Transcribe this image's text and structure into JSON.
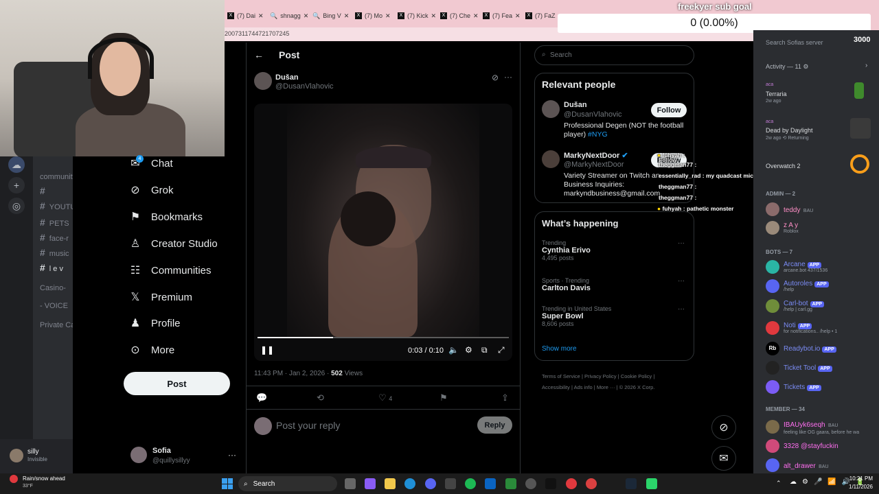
{
  "browser": {
    "tabs": [
      "(7) Dai",
      "shnagg",
      "Bing V",
      "(7) Mo",
      "(7) Kick",
      "(7) Che",
      "(7) Fea",
      "(7) FaZ"
    ],
    "address": "2007311744721707245"
  },
  "x": {
    "header_title": "Post",
    "nav": [
      "Chat",
      "Grok",
      "Bookmarks",
      "Creator Studio",
      "Communities",
      "Premium",
      "Profile",
      "More"
    ],
    "post_button": "Post",
    "account": {
      "name": "Sofia",
      "handle": "@quillysillyy"
    },
    "chat_badge": "4",
    "tweet": {
      "author_name": "Dušan",
      "author_handle": "@DusanVlahovic",
      "video_time": "0:03 / 0:10",
      "video_progress_fraction": 0.3,
      "time": "11:43 PM · Jan 2, 2026 · ",
      "views_count": "502",
      "views_label": " Views",
      "likes": "4",
      "reply_placeholder": "Post your reply",
      "reply_button": "Reply"
    },
    "search_placeholder": "Search",
    "relevant_title": "Relevant people",
    "people": [
      {
        "name": "Dušan",
        "handle": "@DusanVlahovic",
        "bio": "Professional Degen (NOT the football player) ",
        "tag": "#NYG",
        "follow": "Follow"
      },
      {
        "name": "MarkyNextDoor",
        "handle": "@MarkyNextDoor",
        "bio": "Variety Streamer on Twitch an",
        "bio2": "Business Inquiries:",
        "bio3": "markyndbusiness@gmail.com",
        "follow": "Follow"
      }
    ],
    "happening_title": "What’s happening",
    "trends": [
      {
        "meta": "Trending",
        "name": "Cynthia Erivo",
        "posts": "4,495 posts"
      },
      {
        "meta": "Sports · Trending",
        "name": "Carlton Davis",
        "posts": ""
      },
      {
        "meta": "Trending in United States",
        "name": "Super Bowl",
        "posts": "8,606 posts"
      }
    ],
    "show_more": "Show more",
    "footer": [
      "Terms of Service",
      "Privacy Policy",
      "Cookie Policy",
      "Accessibility",
      "Ads info",
      "More ···",
      "© 2026 X Corp."
    ]
  },
  "stream": {
    "goal_title": "freekyer sub goal",
    "goal_value": "0 (0.00%)",
    "chat": [
      {
        "user": "fuhyah",
        "text": ""
      },
      {
        "user": "theggman77",
        "text": ""
      },
      {
        "user": "essentially_rad",
        "text": "my quadcast mic sounds like shit idk how to make it better"
      },
      {
        "user": "theggman77",
        "text": ""
      },
      {
        "user": "theggman77",
        "text": ""
      },
      {
        "user": "fuhyah",
        "text": "pathetic monster"
      }
    ],
    "chat_follow": "Follow"
  },
  "discord": {
    "search_placeholder": "Search Sofias server",
    "counter": "3000",
    "activity": "Activity — 11",
    "activities": [
      {
        "user": "aca",
        "game": "Terraria",
        "time": "2w ago"
      },
      {
        "user": "aca",
        "game": "Dead by Daylight",
        "time": "2w ago",
        "extra": "Returning"
      },
      {
        "user": "aca",
        "game": "Overwatch 2",
        "time": ""
      }
    ],
    "admin_header": "ADMIN — 2",
    "admins": [
      {
        "name": "teddy",
        "tag": "BAU",
        "status": ""
      },
      {
        "name": "z A y",
        "tag": "",
        "status": "Roblox"
      }
    ],
    "bots_header": "BOTS — 7",
    "bots": [
      {
        "name": "Arcane",
        "status": "arcane.bot 437/1536"
      },
      {
        "name": "Autoroles",
        "status": "/help"
      },
      {
        "name": "Carl-bot",
        "status": "/help | carl.gg"
      },
      {
        "name": "Noti",
        "status": "for notifications.. /help • 1"
      },
      {
        "name": "Readybot.io",
        "status": ""
      },
      {
        "name": "Ticket Tool",
        "status": ""
      },
      {
        "name": "Tickets",
        "status": ""
      }
    ],
    "app_label": "APP",
    "member_header": "MEMBER — 34",
    "members": [
      {
        "name": "IBAUyk6seqh",
        "tag": "BAU",
        "status": "feeling like OG gaara, before he wa"
      },
      {
        "name": "3328 @stayfuckin",
        "tag": "",
        "status": ""
      },
      {
        "name": "alt_drawer",
        "tag": "BAU",
        "status": ""
      }
    ],
    "left_channels": [
      "community",
      "YOUTU",
      "PETS",
      "face-r",
      "music",
      "l e v"
    ],
    "casino": "Casino-",
    "voice": "- VOICE",
    "private": "Private Ca",
    "user": {
      "name": "silly",
      "status": "Invisible"
    }
  },
  "taskbar": {
    "weather": "Rain/snow ahead",
    "temp": "33°F",
    "search": "Search",
    "time": "10:21 PM",
    "date": "1/11/2026"
  },
  "colors": {
    "x_bg": "#000000",
    "accent": "#1d9bf0",
    "discord_bg": "#2b2d31",
    "tab_bar": "#f1c9d1"
  }
}
